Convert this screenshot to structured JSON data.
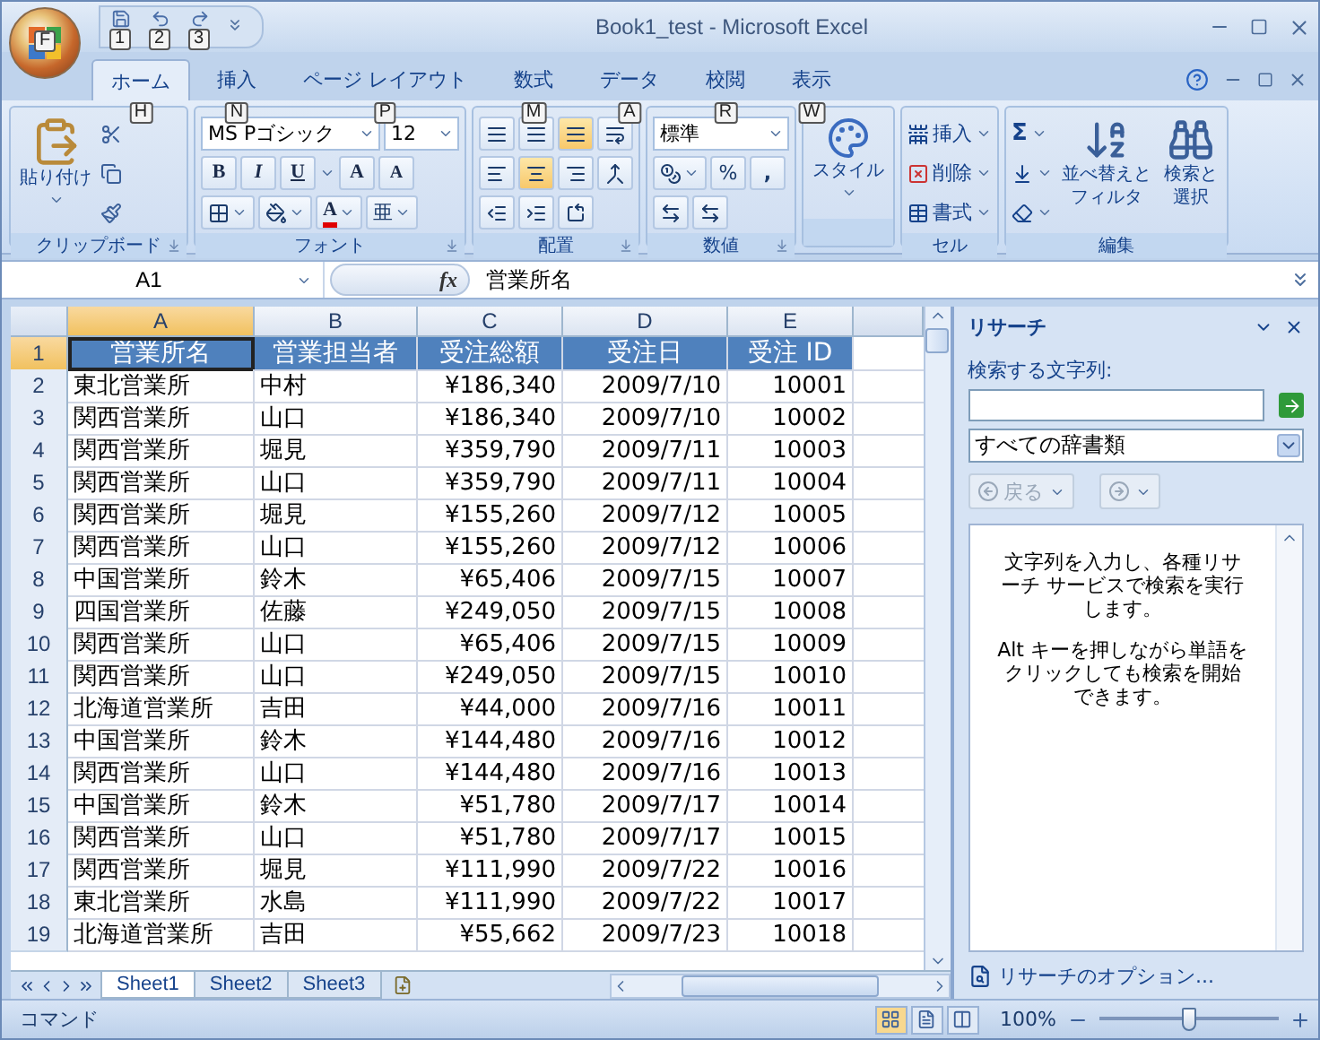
{
  "app_button": {
    "keytip": "F"
  },
  "quick_access": [
    {
      "kind": "save",
      "keytip": "1"
    },
    {
      "kind": "undo",
      "keytip": "2"
    },
    {
      "kind": "redo",
      "keytip": "3"
    }
  ],
  "window": {
    "title": "Book1_test - Microsoft Excel"
  },
  "tabs": [
    {
      "label": "ホーム",
      "keytip": "H",
      "selected": true
    },
    {
      "label": "挿入",
      "keytip": "N",
      "selected": false
    },
    {
      "label": "ページ レイアウト",
      "keytip": "P",
      "selected": false
    },
    {
      "label": "数式",
      "keytip": "M",
      "selected": false
    },
    {
      "label": "データ",
      "keytip": "A",
      "selected": false
    },
    {
      "label": "校閲",
      "keytip": "R",
      "selected": false
    },
    {
      "label": "表示",
      "keytip": "W",
      "selected": false
    }
  ],
  "ribbon": {
    "clipboard": {
      "paste": "貼り付け",
      "label": "クリップボード"
    },
    "font": {
      "name": "MS Pゴシック",
      "size": "12",
      "bold": "B",
      "italic": "I",
      "underline": "U",
      "grow": "A",
      "shrink": "A",
      "color_letter": "A",
      "phonetic": "亜",
      "label": "フォント"
    },
    "alignment": {
      "buttons": [
        {
          "kind": "top",
          "selected": false
        },
        {
          "kind": "middle",
          "selected": false
        },
        {
          "kind": "bottom",
          "selected": true
        },
        {
          "kind": "wrap",
          "selected": false
        },
        {
          "kind": "left",
          "selected": false
        },
        {
          "kind": "center",
          "selected": true
        },
        {
          "kind": "right",
          "selected": false
        },
        {
          "kind": "merge",
          "selected": false
        },
        {
          "kind": "outdent",
          "selected": false
        },
        {
          "kind": "indent",
          "selected": false
        },
        {
          "kind": "orient",
          "selected": false
        }
      ],
      "label": "配置"
    },
    "number": {
      "format": "標準",
      "percent": "%",
      "comma": ",",
      "label": "数値"
    },
    "styles": {
      "label": "スタイル"
    },
    "cells": {
      "items": [
        "挿入",
        "削除",
        "書式"
      ],
      "label": "セル"
    },
    "editing": {
      "autosum": "Σ",
      "sort": [
        "並べ替えと",
        "フィルタ"
      ],
      "find": [
        "検索と",
        "選択"
      ],
      "label": "編集"
    }
  },
  "formula_bar": {
    "name_box": "A1",
    "fx": "fx",
    "content": "営業所名"
  },
  "sheet": {
    "columns": [
      {
        "label": "A",
        "selected": true
      },
      {
        "label": "B",
        "selected": false
      },
      {
        "label": "C",
        "selected": false
      },
      {
        "label": "D",
        "selected": false
      },
      {
        "label": "E",
        "selected": false
      }
    ],
    "rows": [
      {
        "number": "1",
        "kind": "header",
        "selected": true,
        "cells": [
          "営業所名",
          "営業担当者",
          "受注総額",
          "受注日",
          "受注 ID"
        ]
      },
      {
        "number": "2",
        "kind": "data",
        "selected": false,
        "cells": [
          "東北営業所",
          "中村",
          "¥186,340",
          "2009/7/10",
          "10001"
        ]
      },
      {
        "number": "3",
        "kind": "data",
        "selected": false,
        "cells": [
          "関西営業所",
          "山口",
          "¥186,340",
          "2009/7/10",
          "10002"
        ]
      },
      {
        "number": "4",
        "kind": "data",
        "selected": false,
        "cells": [
          "関西営業所",
          "堀見",
          "¥359,790",
          "2009/7/11",
          "10003"
        ]
      },
      {
        "number": "5",
        "kind": "data",
        "selected": false,
        "cells": [
          "関西営業所",
          "山口",
          "¥359,790",
          "2009/7/11",
          "10004"
        ]
      },
      {
        "number": "6",
        "kind": "data",
        "selected": false,
        "cells": [
          "関西営業所",
          "堀見",
          "¥155,260",
          "2009/7/12",
          "10005"
        ]
      },
      {
        "number": "7",
        "kind": "data",
        "selected": false,
        "cells": [
          "関西営業所",
          "山口",
          "¥155,260",
          "2009/7/12",
          "10006"
        ]
      },
      {
        "number": "8",
        "kind": "data",
        "selected": false,
        "cells": [
          "中国営業所",
          "鈴木",
          "¥65,406",
          "2009/7/15",
          "10007"
        ]
      },
      {
        "number": "9",
        "kind": "data",
        "selected": false,
        "cells": [
          "四国営業所",
          "佐藤",
          "¥249,050",
          "2009/7/15",
          "10008"
        ]
      },
      {
        "number": "10",
        "kind": "data",
        "selected": false,
        "cells": [
          "関西営業所",
          "山口",
          "¥65,406",
          "2009/7/15",
          "10009"
        ]
      },
      {
        "number": "11",
        "kind": "data",
        "selected": false,
        "cells": [
          "関西営業所",
          "山口",
          "¥249,050",
          "2009/7/15",
          "10010"
        ]
      },
      {
        "number": "12",
        "kind": "data",
        "selected": false,
        "cells": [
          "北海道営業所",
          "吉田",
          "¥44,000",
          "2009/7/16",
          "10011"
        ]
      },
      {
        "number": "13",
        "kind": "data",
        "selected": false,
        "cells": [
          "中国営業所",
          "鈴木",
          "¥144,480",
          "2009/7/16",
          "10012"
        ]
      },
      {
        "number": "14",
        "kind": "data",
        "selected": false,
        "cells": [
          "関西営業所",
          "山口",
          "¥144,480",
          "2009/7/16",
          "10013"
        ]
      },
      {
        "number": "15",
        "kind": "data",
        "selected": false,
        "cells": [
          "中国営業所",
          "鈴木",
          "¥51,780",
          "2009/7/17",
          "10014"
        ]
      },
      {
        "number": "16",
        "kind": "data",
        "selected": false,
        "cells": [
          "関西営業所",
          "山口",
          "¥51,780",
          "2009/7/17",
          "10015"
        ]
      },
      {
        "number": "17",
        "kind": "data",
        "selected": false,
        "cells": [
          "関西営業所",
          "堀見",
          "¥111,990",
          "2009/7/22",
          "10016"
        ]
      },
      {
        "number": "18",
        "kind": "data",
        "selected": false,
        "cells": [
          "東北営業所",
          "水島",
          "¥111,990",
          "2009/7/22",
          "10017"
        ]
      },
      {
        "number": "19",
        "kind": "data",
        "selected": false,
        "cells": [
          "北海道営業所",
          "吉田",
          "¥55,662",
          "2009/7/23",
          "10018"
        ]
      }
    ]
  },
  "sheet_tabs": [
    {
      "label": "Sheet1",
      "selected": true
    },
    {
      "label": "Sheet2",
      "selected": false
    },
    {
      "label": "Sheet3",
      "selected": false
    }
  ],
  "research": {
    "title": "リサーチ",
    "search_label": "検索する文字列:",
    "source": "すべての辞書類",
    "back": "戻る",
    "back_disabled": true,
    "forward_disabled": true,
    "messages": [
      "文字列を入力し、各種リサーチ サービスで検索を実行します。",
      "Alt キーを押しながら単語をクリックしても検索を開始できます。"
    ],
    "options_link": "リサーチのオプション..."
  },
  "status_bar": {
    "mode": "コマンド",
    "views": [
      {
        "kind": "normal",
        "selected": true
      },
      {
        "kind": "layout",
        "selected": false
      },
      {
        "kind": "pagebreak",
        "selected": false
      }
    ],
    "zoom": "100%",
    "zoom_slider": {
      "level": 0.5
    }
  }
}
